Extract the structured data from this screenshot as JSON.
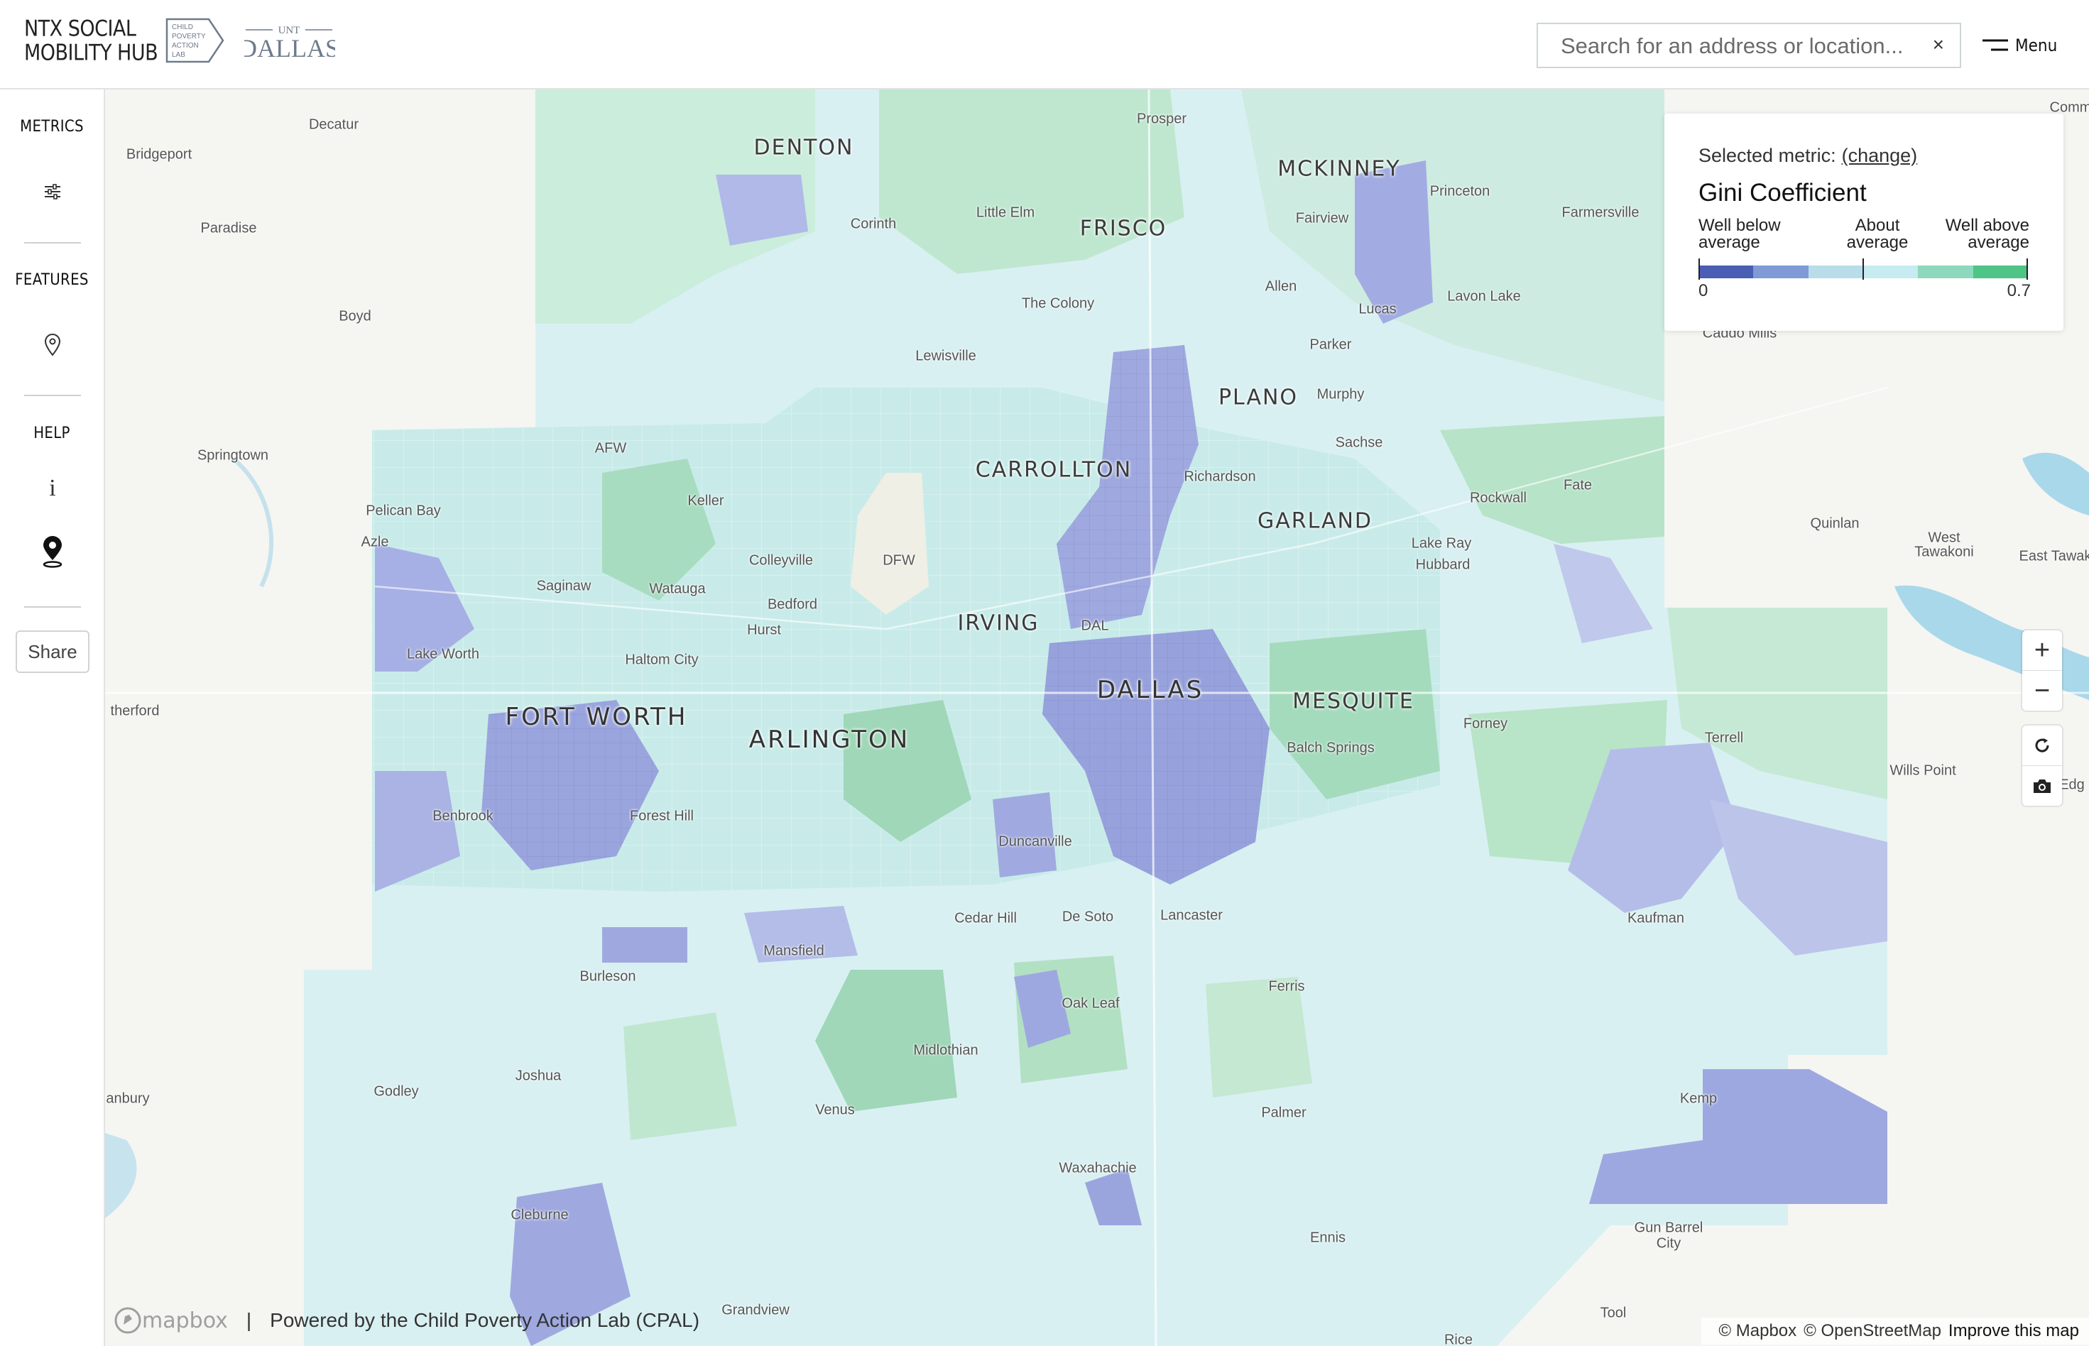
{
  "brand": {
    "line1": "NTX SOCIAL",
    "line2": "MOBILITY HUB"
  },
  "logos": {
    "cpal_lines": [
      "CHILD",
      "POVERTY",
      "ACTION",
      "LAB"
    ],
    "unt_small": "UNT",
    "unt_big": "DALLAS"
  },
  "search": {
    "placeholder": "Search for an address or location...",
    "clear": "×"
  },
  "menu": {
    "label": "Menu"
  },
  "sidebar": {
    "metrics_heading": "METRICS",
    "features_heading": "FEATURES",
    "help_heading": "HELP",
    "info_glyph": "i",
    "share_label": "Share"
  },
  "legend": {
    "selected_prefix": "Selected metric:",
    "change_link": "(change)",
    "metric_name": "Gini Coefficient",
    "below_line1": "Well below",
    "below_line2": "average",
    "about_line1": "About",
    "about_line2": "average",
    "above_line1": "Well above",
    "above_line2": "average",
    "min_value": "0",
    "max_value": "0.7",
    "colors": [
      "#4a5eb4",
      "#7f9ad6",
      "#b8dde8",
      "#c6ebf0",
      "#8ed8bd",
      "#4fc487"
    ]
  },
  "map_labels": {
    "cities": [
      "DENTON",
      "MCKINNEY",
      "FRISCO",
      "PLANO",
      "CARROLLTON",
      "GARLAND",
      "IRVING",
      "DALLAS",
      "MESQUITE",
      "FORT WORTH",
      "ARLINGTON"
    ],
    "places": [
      "Decatur",
      "Bridgeport",
      "Paradise",
      "Boyd",
      "Springtown",
      "Pelican Bay",
      "Azle",
      "Saginaw",
      "Lake Worth",
      "Haltom City",
      "Watauga",
      "Keller",
      "AFW",
      "Colleyville",
      "Bedford",
      "Hurst",
      "DFW",
      "DAL",
      "Lewisville",
      "The Colony",
      "Little Elm",
      "Corinth",
      "Prosper",
      "Fairview",
      "Allen",
      "Lucas",
      "Princeton",
      "Farmersville",
      "Lavon Lake",
      "Caddo Mills",
      "Parker",
      "Murphy",
      "Sachse",
      "Richardson",
      "Rockwall",
      "Fate",
      "Lake Ray",
      "Hubbard",
      "Quinlan",
      "West",
      "Tawakoni",
      "East Tawako",
      "Forney",
      "Terrell",
      "Wills Point",
      "Balch Springs",
      "Kaufman",
      "Benbrook",
      "Forest Hill",
      "Duncanville",
      "Cedar Hill",
      "De Soto",
      "Lancaster",
      "Mansfield",
      "Burleson",
      "Oak Leaf",
      "Ferris",
      "Midlothian",
      "Joshua",
      "Godley",
      "anbury",
      "therford",
      "Venus",
      "Palmer",
      "Waxahachie",
      "Kemp",
      "Cleburne",
      "Ennis",
      "Gun Barrel",
      "City",
      "Grandview",
      "Tool",
      "Rice",
      "Comm",
      "Edg"
    ]
  },
  "map": {
    "water_color": "#a9d8ea",
    "land_color": "#f5f5f2",
    "choropleth_colors": [
      "#b3bde8",
      "#9fa9e0",
      "#dff1f4",
      "#cdeaf0",
      "#bfe7d6",
      "#a8dcc0",
      "#8fd1ad"
    ]
  },
  "controls": {
    "zoom_in": "+",
    "zoom_out": "−"
  },
  "attribution": {
    "mapbox_logo": "mapbox",
    "separator": "|",
    "powered_by": "Powered by the Child Poverty Action Lab (CPAL)",
    "mapbox_credit": "© Mapbox",
    "osm_credit": "© OpenStreetMap",
    "improve": "Improve this map"
  }
}
